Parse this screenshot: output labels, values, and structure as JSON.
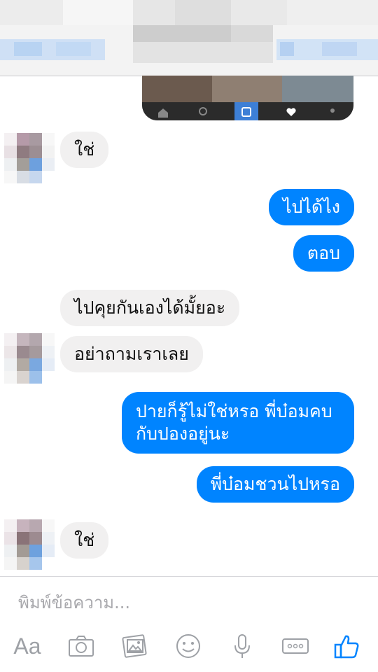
{
  "messages": [
    {
      "side": "in",
      "text": "ใช่"
    },
    {
      "side": "out",
      "text": "ไปได้ไง"
    },
    {
      "side": "out",
      "text": "ตอบ"
    },
    {
      "side": "in",
      "text": "ไปคุยกันเองได้มั้ยอะ"
    },
    {
      "side": "in",
      "text": "อย่าถามเราเลย"
    },
    {
      "side": "out",
      "line1": "ปายก็รู้ไม่ใช่หรอ พี่บ๋อมคบ",
      "line2": "กับปองอยู่นะ"
    },
    {
      "side": "out",
      "text": "พี่บ๋อมชวนไปหรอ"
    },
    {
      "side": "in",
      "text": "ใช่"
    }
  ],
  "composer": {
    "placeholder": "พิมพ์ข้อความ...",
    "aa_label": "Aa",
    "icons": [
      "text-format-icon",
      "camera-icon",
      "gallery-icon",
      "sticker-icon",
      "microphone-icon",
      "more-icon",
      "like-icon"
    ]
  },
  "colors": {
    "outgoing": "#0084ff",
    "incoming": "#f1f0f0",
    "icon_gray": "#9ea1a6"
  }
}
